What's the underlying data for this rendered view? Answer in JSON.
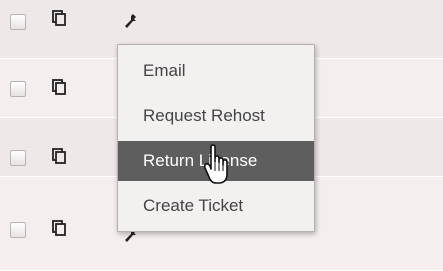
{
  "rows": [
    {
      "checkbox": "unchecked",
      "copy_icon": "copy-icon",
      "action_icon": "wrench-icon"
    },
    {
      "checkbox": "unchecked",
      "copy_icon": "copy-icon"
    },
    {
      "checkbox": "unchecked",
      "copy_icon": "copy-icon"
    },
    {
      "checkbox": "unchecked",
      "copy_icon": "copy-icon",
      "action_icon": "wrench-icon"
    }
  ],
  "context_menu": {
    "items": [
      {
        "label": "Email"
      },
      {
        "label": "Request Rehost"
      },
      {
        "label": "Return License",
        "state": "hover"
      },
      {
        "label": "Create Ticket"
      }
    ],
    "hover_background": "#5e5e5e"
  },
  "cursor": "hand-pointer-icon"
}
